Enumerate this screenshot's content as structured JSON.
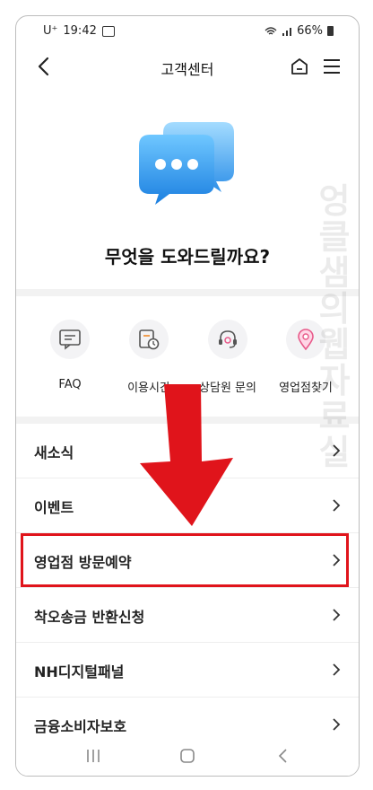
{
  "status_bar": {
    "carrier": "U⁺",
    "time": "19:42",
    "battery": "66%"
  },
  "app_bar": {
    "title": "고객센터",
    "icons": [
      "back-icon",
      "home-icon",
      "menu-icon"
    ]
  },
  "hero": {
    "icon": "chat-bubbles-icon",
    "heading": "무엇을 도와드릴까요?"
  },
  "quick_menu": [
    {
      "label": "FAQ",
      "icon": "faq-icon"
    },
    {
      "label": "이용시간",
      "icon": "clock-icon"
    },
    {
      "label": "상담원 문의",
      "icon": "headset-icon"
    },
    {
      "label": "영업점찾기",
      "icon": "location-pin-icon"
    }
  ],
  "list": [
    {
      "label": "새소식"
    },
    {
      "label": "이벤트"
    },
    {
      "label": "영업점 방문예약"
    },
    {
      "label": "착오송금 반환신청"
    },
    {
      "label": "NH디지털패널"
    },
    {
      "label": "금융소비자보호"
    }
  ],
  "watermark": "엉클샘의 웹자료실",
  "colors": {
    "accent": "#e0141b",
    "bubble_blue": "#3fa3f0"
  }
}
